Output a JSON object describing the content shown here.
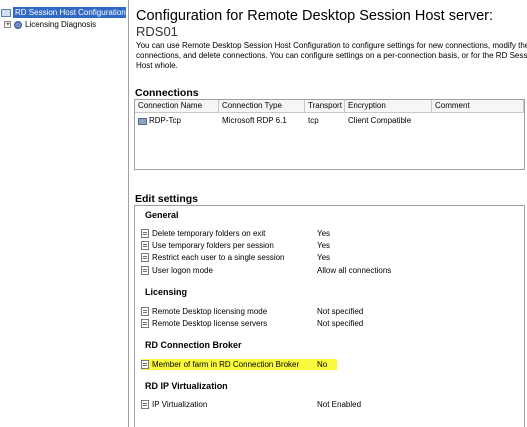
{
  "tree": {
    "root_label": "RD Session Host Configuration:",
    "root_icon": "server-config-icon",
    "children": [
      {
        "label": "Licensing Diagnosis",
        "expander": "+",
        "icon": "diagnosis-icon"
      }
    ]
  },
  "main": {
    "title": "Configuration for Remote Desktop Session Host server:",
    "server_name": "RDS01",
    "description": "You can use Remote Desktop Session Host Configuration to configure settings for new connections, modify the settin connections, and delete connections. You can configure settings on a per-connection basis, or for the RD Session Host whole."
  },
  "connections": {
    "heading": "Connections",
    "columns": [
      "Connection Name",
      "Connection Type",
      "Transport",
      "Encryption",
      "Comment"
    ],
    "rows": [
      {
        "name": "RDP-Tcp",
        "type": "Microsoft RDP 6.1",
        "transport": "tcp",
        "encryption": "Client Compatible",
        "comment": ""
      }
    ]
  },
  "edit_settings": {
    "heading": "Edit settings",
    "groups": [
      {
        "title": "General",
        "items": [
          {
            "label": "Delete temporary folders on exit",
            "value": "Yes"
          },
          {
            "label": "Use temporary folders per session",
            "value": "Yes"
          },
          {
            "label": "Restrict each user to a single session",
            "value": "Yes"
          },
          {
            "label": "User logon mode",
            "value": "Allow all connections"
          }
        ]
      },
      {
        "title": "Licensing",
        "items": [
          {
            "label": "Remote Desktop licensing mode",
            "value": "Not specified"
          },
          {
            "label": "Remote Desktop license servers",
            "value": "Not specified"
          }
        ]
      },
      {
        "title": "RD Connection Broker",
        "items": [
          {
            "label": "Member of farm in RD Connection Broker",
            "value": "No",
            "highlighted": true
          }
        ]
      },
      {
        "title": "RD IP Virtualization",
        "items": [
          {
            "label": "IP Virtualization",
            "value": "Not Enabled"
          }
        ]
      }
    ]
  },
  "colors": {
    "selection": "#3169c6",
    "highlight": "#fafa3c"
  }
}
